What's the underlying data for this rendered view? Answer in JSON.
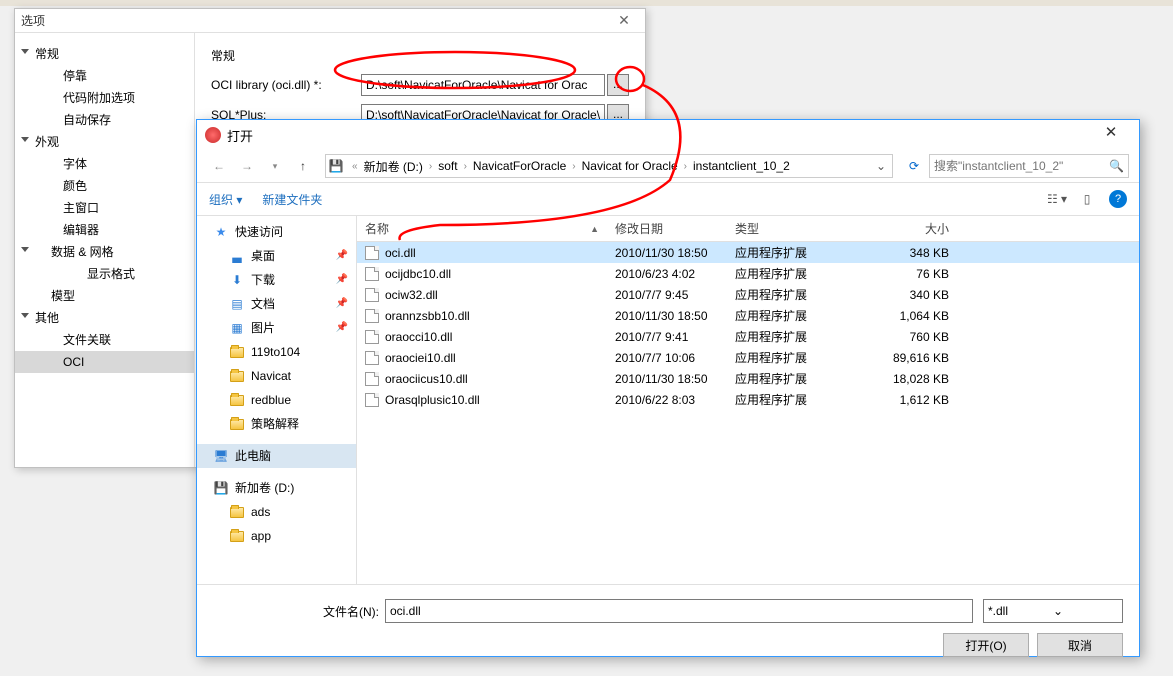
{
  "options": {
    "title": "选项",
    "tree": {
      "general": "常规",
      "dock": "停靠",
      "code_addon": "代码附加选项",
      "autosave": "自动保存",
      "appearance": "外观",
      "font": "字体",
      "color": "颜色",
      "mainwindow": "主窗口",
      "editor": "编辑器",
      "data_net": "数据 & 网格",
      "display_fmt": "显示格式",
      "model": "模型",
      "other": "其他",
      "file_assoc": "文件关联",
      "oci": "OCI"
    },
    "section": "常规",
    "oci_label": "OCI library (oci.dll) *:",
    "oci_value": "D:\\soft\\NavicatForOracle\\Navicat for Orac",
    "sqlplus_label": "SQL*Plus:",
    "sqlplus_value": "D:\\soft\\NavicatForOracle\\Navicat for Oracle\\",
    "browse": "..."
  },
  "filedlg": {
    "title": "打开",
    "breadcrumb": [
      "新加卷 (D:)",
      "soft",
      "NavicatForOracle",
      "Navicat for Oracle",
      "instantclient_10_2"
    ],
    "search_placeholder": "搜索\"instantclient_10_2\"",
    "organize": "组织",
    "new_folder": "新建文件夹",
    "columns": {
      "name": "名称",
      "date": "修改日期",
      "type": "类型",
      "size": "大小"
    },
    "sidebar": {
      "quick": "快速访问",
      "desktop": "桌面",
      "downloads": "下载",
      "documents": "文档",
      "pictures": "图片",
      "f1": "119to104",
      "f2": "Navicat",
      "f3": "redblue",
      "f4": "策略解释",
      "thispc": "此电脑",
      "drive": "新加卷 (D:)",
      "ads": "ads",
      "app": "app"
    },
    "files": [
      {
        "name": "oci.dll",
        "date": "2010/11/30 18:50",
        "type": "应用程序扩展",
        "size": "348 KB",
        "selected": true
      },
      {
        "name": "ocijdbc10.dll",
        "date": "2010/6/23 4:02",
        "type": "应用程序扩展",
        "size": "76 KB"
      },
      {
        "name": "ociw32.dll",
        "date": "2010/7/7 9:45",
        "type": "应用程序扩展",
        "size": "340 KB"
      },
      {
        "name": "orannzsbb10.dll",
        "date": "2010/11/30 18:50",
        "type": "应用程序扩展",
        "size": "1,064 KB"
      },
      {
        "name": "oraocci10.dll",
        "date": "2010/7/7 9:41",
        "type": "应用程序扩展",
        "size": "760 KB"
      },
      {
        "name": "oraociei10.dll",
        "date": "2010/7/7 10:06",
        "type": "应用程序扩展",
        "size": "89,616 KB"
      },
      {
        "name": "oraociicus10.dll",
        "date": "2010/11/30 18:50",
        "type": "应用程序扩展",
        "size": "18,028 KB"
      },
      {
        "name": "Orasqlplusic10.dll",
        "date": "2010/6/22 8:03",
        "type": "应用程序扩展",
        "size": "1,612 KB"
      }
    ],
    "filename_label": "文件名(N):",
    "filename_value": "oci.dll",
    "filter": "*.dll",
    "open_btn": "打开(O)",
    "cancel_btn": "取消"
  }
}
